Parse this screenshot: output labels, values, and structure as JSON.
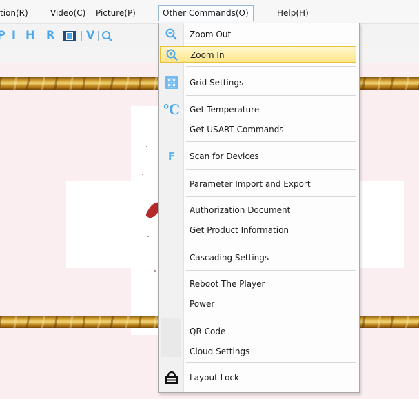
{
  "menubar": {
    "items": [
      {
        "label": "tion(R)"
      },
      {
        "label": "Video(C)"
      },
      {
        "label": "Picture(P)"
      },
      {
        "label": "Other Commands(O)"
      },
      {
        "label": "Help(H)"
      }
    ]
  },
  "toolbar": {
    "buttons": [
      {
        "glyph": "P"
      },
      {
        "glyph": "I"
      },
      {
        "glyph": "H"
      },
      {
        "glyph": "R"
      },
      {
        "glyph": "V"
      }
    ]
  },
  "dropdown": {
    "items": [
      {
        "label": "Zoom Out",
        "icon": "zoom-out-icon"
      },
      {
        "label": "Zoom In",
        "icon": "zoom-in-icon",
        "highlighted": true
      },
      {
        "label": "Grid Settings",
        "icon": "grid-icon"
      },
      {
        "label": "Get Temperature",
        "icon": "celsius-icon",
        "icon_glyph": "℃"
      },
      {
        "label": "Get USART Commands"
      },
      {
        "label": "Scan for Devices",
        "icon": "scan-icon",
        "icon_glyph": "F"
      },
      {
        "label": "Parameter Import and Export"
      },
      {
        "label": "Authorization Document"
      },
      {
        "label": "Get Product Information"
      },
      {
        "label": "Cascading Settings"
      },
      {
        "label": "Reboot The Player"
      },
      {
        "label": "Power"
      },
      {
        "label": "QR Code"
      },
      {
        "label": "Cloud Settings"
      },
      {
        "label": "Layout Lock",
        "icon": "lock-icon"
      }
    ]
  },
  "colors": {
    "accent": "#49a8ef",
    "highlight": "#ffe589",
    "menu_open_border": "#9bb8d6"
  }
}
